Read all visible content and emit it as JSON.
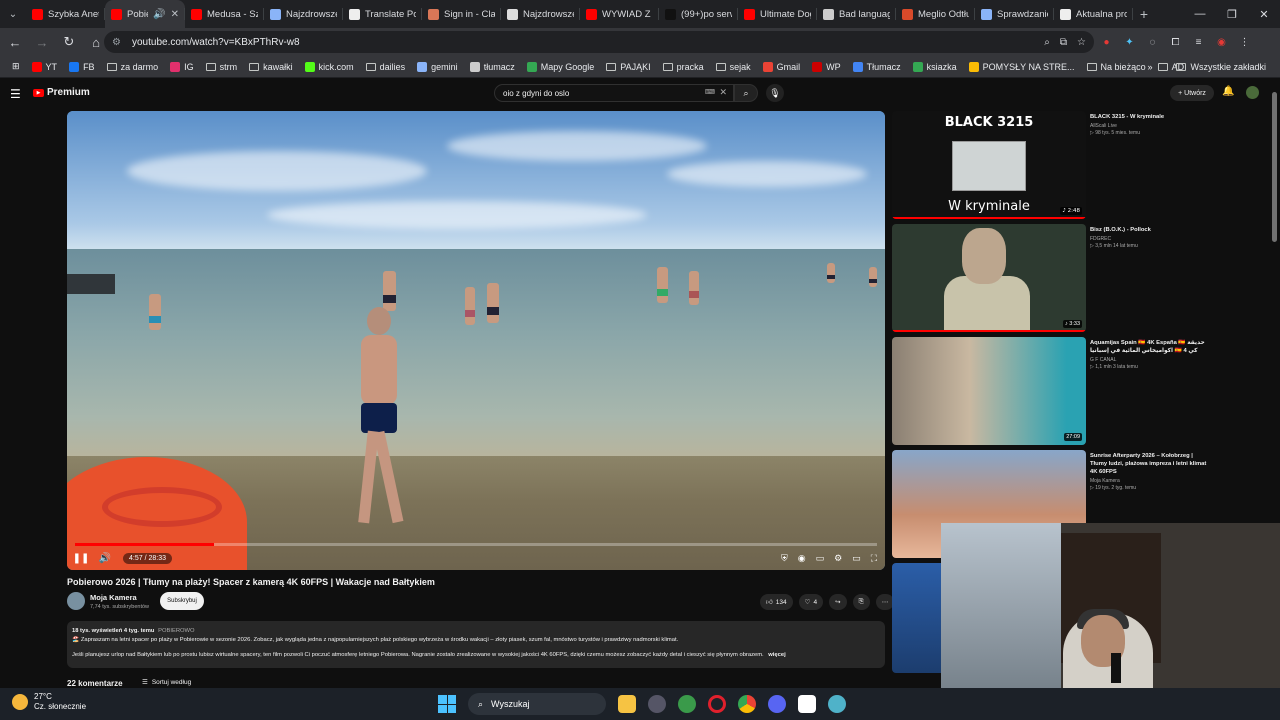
{
  "browser": {
    "tabs": [
      {
        "label": "Szybka Aneta",
        "color": "#ff0000",
        "active": false
      },
      {
        "label": "Pobie",
        "color": "#ff0000",
        "active": true
      },
      {
        "label": "Medusa - Sza",
        "color": "#ff0000",
        "active": false
      },
      {
        "label": "Najzdrowsze",
        "color": "#8ab4f8",
        "active": false
      },
      {
        "label": "Translate Pol",
        "color": "#eeeeee",
        "active": false
      },
      {
        "label": "Sign in - Clau",
        "color": "#d97757",
        "active": false
      },
      {
        "label": "Najzdrowsze",
        "color": "#dddddd",
        "active": false
      },
      {
        "label": "WYWIAD Z M",
        "color": "#ff0000",
        "active": false
      },
      {
        "label": "(99+)po serw",
        "color": "#111111",
        "active": false
      },
      {
        "label": "Ultimate Dog",
        "color": "#ff0000",
        "active": false
      },
      {
        "label": "Bad language",
        "color": "#cccccc",
        "active": false
      },
      {
        "label": "Meglio Odtłu",
        "color": "#d94a2a",
        "active": false
      },
      {
        "label": "Sprawdzanie",
        "color": "#8ab4f8",
        "active": false
      },
      {
        "label": "Aktualna pro",
        "color": "#eeeeee",
        "active": false
      }
    ],
    "url": "youtube.com/watch?v=KBxPThRv-w8",
    "bookmarks": [
      {
        "label": "YT",
        "color": "#ff0000"
      },
      {
        "label": "FB",
        "color": "#1877f2"
      },
      {
        "label": "za darmo",
        "folder": true
      },
      {
        "label": "IG",
        "color": "#e1306c"
      },
      {
        "label": "strm",
        "folder": true
      },
      {
        "label": "kawałki",
        "folder": true
      },
      {
        "label": "kick.com",
        "color": "#53fc18"
      },
      {
        "label": "dailies",
        "folder": true
      },
      {
        "label": "gemini",
        "color": "#8ab4f8"
      },
      {
        "label": "tłumacz",
        "color": "#cccccc"
      },
      {
        "label": "Mapy Google",
        "color": "#34a853"
      },
      {
        "label": "PAJĄKI",
        "folder": true
      },
      {
        "label": "pracka",
        "folder": true
      },
      {
        "label": "sejak",
        "folder": true
      },
      {
        "label": "Gmail",
        "color": "#ea4335"
      },
      {
        "label": "WP",
        "color": "#cc0000"
      },
      {
        "label": "Tłumacz",
        "color": "#4285f4"
      },
      {
        "label": "ksiazka",
        "color": "#34a853"
      },
      {
        "label": "POMYSŁY NA STRE...",
        "color": "#fbbc05"
      },
      {
        "label": "Na bieżąco",
        "folder": true
      },
      {
        "label": "AD",
        "folder": true
      }
    ],
    "bookmarks_all": "Wszystkie zakładki"
  },
  "youtube": {
    "logo": "Premium",
    "search_query": "oio z gdyni do oslo",
    "create_label": "Utwórz",
    "video": {
      "time": "4:57 / 28:33",
      "progress_fraction": 0.173,
      "title": "Pobierowo 2026 | Tłumy na plaży! Spacer z kamerą 4K 60FPS | Wakacje nad Bałtykiem",
      "channel": "Moja Kamera",
      "subscribers": "7,74 tys. subskrybentów",
      "subscribe_label": "Subskrybuj",
      "likes": "134",
      "dislikes": "4",
      "meta": "18 tys. wyświetleń  4 tyg. temu",
      "tag": "POBIEROWO",
      "desc1": "🏖️ Zapraszam na letni spacer po plaży w Pobierowie w sezonie 2026. Zobacz, jak wygląda jedna z najpopularniejszych plaż polskiego wybrzeża w środku wakacji – złoty piasek, szum fal, mnóstwo turystów i prawdziwy nadmorski klimat.",
      "desc2": "Jeśli planujesz urlop nad Bałtykiem lub po prostu lubisz wirtualne spacery, ten film pozwoli Ci poczuć atmosferę letniego Pobierowa. Nagranie zostało zrealizowane w wysokiej jakości 4K 60FPS, dzięki czemu możesz zobaczyć każdy detal i cieszyć się płynnym obrazem.",
      "more": "więcej",
      "comments": "22 komentarze",
      "sort": "Sortuj według"
    },
    "recommendations": [
      {
        "title": "BLACK 3215 - W kryminale",
        "channel": "AllScali Live",
        "meta": "▷ 98 tys.  5 mies. temu",
        "duration": "♪ 2:48",
        "thumb_top": "BLACK 3215",
        "thumb_bottom": "W kryminale",
        "watched": 1.0
      },
      {
        "title": "Bisz (B.O.K.) - Pollock",
        "channel": "FDGREC",
        "meta": "▷ 3,5 mln  14 lat temu",
        "duration": "♪ 3:33",
        "watched": 1.0
      },
      {
        "title": "Aquamijas Spain 🇪🇸 4K España 🇪🇸 حديقة اكواميخاس المائية في إسبانيا 🇪🇸 4 كي",
        "channel": "G F CANAL",
        "meta": "▷ 1,1 mln  3 lata temu",
        "duration": "27:09",
        "watched": 0.0
      },
      {
        "title": "Sunrise Afterparty 2026 – Kołobrzeg | Tłumy ludzi, plażowa impreza i letni klimat 4K 60FPS",
        "channel": "Moja Kamera",
        "meta": "▷ 19 tys.  2 tyg. temu",
        "duration": "",
        "watched": 0.0
      }
    ]
  },
  "taskbar": {
    "temp": "27°C",
    "weather": "Cz. słonecznie",
    "search": "Wyszukaj"
  }
}
